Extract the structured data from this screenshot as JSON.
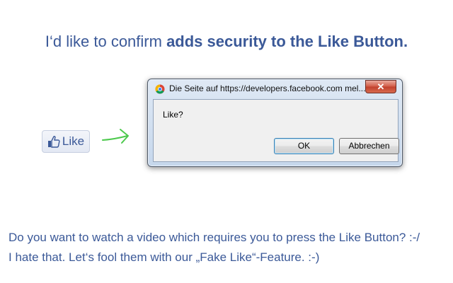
{
  "headline": {
    "prefix": "I‘d like to confirm ",
    "bold": "adds security to the Like Button."
  },
  "like_button": {
    "label": "Like",
    "icon": "thumbs-up-icon"
  },
  "arrow": {
    "icon": "arrow-right-icon",
    "color": "#4cc94c"
  },
  "dialog": {
    "title": "Die Seite auf https://developers.facebook.com mel...",
    "close_symbol": "✕",
    "message": "Like?",
    "ok_label": "OK",
    "cancel_label": "Abbrechen"
  },
  "body": {
    "line1": "Do you want to watch a video which requires you to press the Like Button? :-/",
    "line2": "I hate that. Let‘s fool them with our „Fake Like“-Feature. :-)"
  },
  "colors": {
    "brand": "#3b5998",
    "close_red": "#c0402c"
  }
}
